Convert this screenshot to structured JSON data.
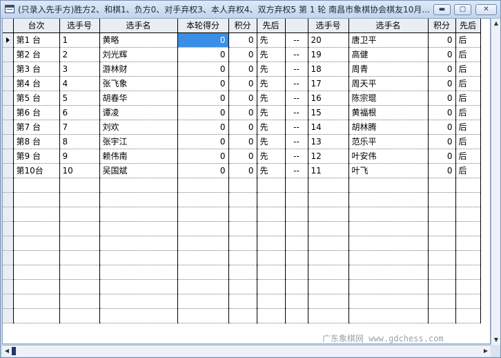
{
  "window": {
    "title": "(只录入先手方)胜方2、和棋1、负方0、对手弃权3、本人弃权4、双方弃权5  第 1 轮 南昌市象棋协会棋友10月...",
    "minimize_glyph": "▬",
    "maximize_glyph": "▢",
    "close_glyph": "✕"
  },
  "grid": {
    "headers": [
      "台次",
      "选手号",
      "选手名",
      "本轮得分",
      "积分",
      "先后",
      "",
      "选手号",
      "选手名",
      "积分",
      "先后"
    ],
    "rows": [
      [
        "第1  台",
        "1",
        "黄略",
        "0",
        "0",
        "先",
        "--",
        "20",
        "唐卫平",
        "0",
        "后"
      ],
      [
        "第2  台",
        "2",
        "刘光辉",
        "0",
        "0",
        "先",
        "--",
        "19",
        "高健",
        "0",
        "后"
      ],
      [
        "第3  台",
        "3",
        "游林财",
        "0",
        "0",
        "先",
        "--",
        "18",
        "周青",
        "0",
        "后"
      ],
      [
        "第4  台",
        "4",
        "张飞象",
        "0",
        "0",
        "先",
        "--",
        "17",
        "周天平",
        "0",
        "后"
      ],
      [
        "第5  台",
        "5",
        "胡春华",
        "0",
        "0",
        "先",
        "--",
        "16",
        "陈宗琨",
        "0",
        "后"
      ],
      [
        "第6  台",
        "6",
        "谭凌",
        "0",
        "0",
        "先",
        "--",
        "15",
        "黄福根",
        "0",
        "后"
      ],
      [
        "第7  台",
        "7",
        "刘欢",
        "0",
        "0",
        "先",
        "--",
        "14",
        "胡林腾",
        "0",
        "后"
      ],
      [
        "第8  台",
        "8",
        "张宇江",
        "0",
        "0",
        "先",
        "--",
        "13",
        "范乐平",
        "0",
        "后"
      ],
      [
        "第9  台",
        "9",
        "赖伟南",
        "0",
        "0",
        "先",
        "--",
        "12",
        "叶安伟",
        "0",
        "后"
      ],
      [
        "第10台",
        "10",
        "吴国斌",
        "0",
        "0",
        "先",
        "--",
        "11",
        "叶飞",
        "0",
        "后"
      ]
    ],
    "empty_rows": 10,
    "selected_row": 0,
    "selected_col": 3
  },
  "watermark": "广东象棋网 www.gdchess.com",
  "colors": {
    "selection": "#3a8ee6",
    "header_bg": "#e9edf4",
    "chrome": "#c6d8ef"
  }
}
